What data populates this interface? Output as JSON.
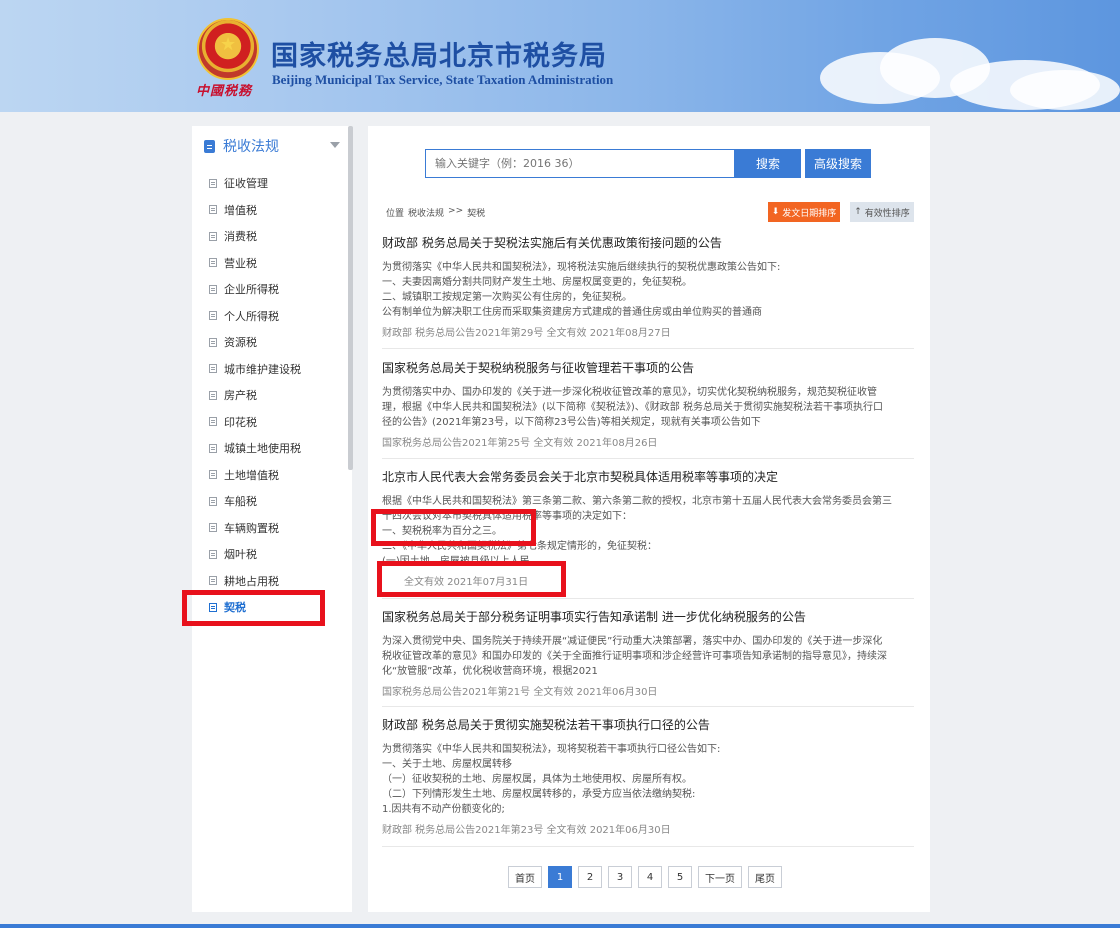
{
  "header": {
    "title_cn": "国家税务总局北京市税务局",
    "title_en": "Beijing Municipal Tax Service, State Taxation Administration",
    "emblem_text": "中國税務"
  },
  "sidebar": {
    "heading": "税收法规",
    "items": [
      {
        "label": "征收管理"
      },
      {
        "label": "增值税"
      },
      {
        "label": "消费税"
      },
      {
        "label": "营业税"
      },
      {
        "label": "企业所得税"
      },
      {
        "label": "个人所得税"
      },
      {
        "label": "资源税"
      },
      {
        "label": "城市维护建设税"
      },
      {
        "label": "房产税"
      },
      {
        "label": "印花税"
      },
      {
        "label": "城镇土地使用税"
      },
      {
        "label": "土地增值税"
      },
      {
        "label": "车船税"
      },
      {
        "label": "车辆购置税"
      },
      {
        "label": "烟叶税"
      },
      {
        "label": "耕地占用税"
      },
      {
        "label": "契税"
      }
    ]
  },
  "search": {
    "placeholder": "输入关键字（例：2016 36）",
    "search_label": "搜索",
    "advanced_label": "高级搜索"
  },
  "breadcrumb": {
    "prefix": "位置",
    "level1": "税收法规",
    "separator": ">>",
    "level2": "契税"
  },
  "sort": {
    "by_date": "发文日期排序",
    "by_validity": "有效性排序"
  },
  "articles": [
    {
      "title": "财政部 税务总局关于契税法实施后有关优惠政策衔接问题的公告",
      "lines": [
        "为贯彻落实《中华人民共和国契税法》，现将税法实施后继续执行的契税优惠政策公告如下:",
        "一、夫妻因离婚分割共同财产发生土地、房屋权属变更的，免征契税。",
        "二、城镇职工按规定第一次购买公有住房的，免征契税。",
        "公有制单位为解决职工住房而采取集资建房方式建成的普通住房或由单位购买的普通商"
      ],
      "meta": "财政部 税务总局公告2021年第29号   全文有效   2021年08月27日"
    },
    {
      "title": "国家税务总局关于契税纳税服务与征收管理若干事项的公告",
      "lines": [
        "为贯彻落实中办、国办印发的《关于进一步深化税收征管改革的意见》，切实优化契税纳税服务，规范契税征收管",
        "理，根据《中华人民共和国契税法》(以下简称《契税法》)、《财政部 税务总局关于贯彻实施契税法若干事项执行口",
        "径的公告》(2021年第23号，以下简称23号公告)等相关规定，现就有关事项公告如下"
      ],
      "meta": "国家税务总局公告2021年第25号   全文有效   2021年08月26日"
    },
    {
      "title": "北京市人民代表大会常务委员会关于北京市契税具体适用税率等事项的决定",
      "lines": [
        "根据《中华人民共和国契税法》第三条第二款、第六条第二款的授权，北京市第十五届人民代表大会常务委员会第三",
        "十四次会议对本市契税具体适用税率等事项的决定如下：",
        "一、契税税率为百分之三。",
        "二、《中华人民共和国契税法》第七条规定情形的，免征契税：",
        "(一)因土地、房屋被县级以上人民"
      ],
      "meta": "全文有效   2021年07月31日"
    },
    {
      "title": "国家税务总局关于部分税务证明事项实行告知承诺制 进一步优化纳税服务的公告",
      "lines": [
        "为深入贯彻党中央、国务院关于持续开展“减证便民”行动重大决策部署，落实中办、国办印发的《关于进一步深化",
        "税收征管改革的意见》和国办印发的《关于全面推行证明事项和涉企经营许可事项告知承诺制的指导意见》，持续深",
        "化“放管服”改革，优化税收营商环境，根据2021"
      ],
      "meta": "国家税务总局公告2021年第21号   全文有效   2021年06月30日"
    },
    {
      "title": "财政部 税务总局关于贯彻实施契税法若干事项执行口径的公告",
      "lines": [
        "为贯彻落实《中华人民共和国契税法》，现将契税若干事项执行口径公告如下:",
        "一、关于土地、房屋权属转移",
        "（一）征收契税的土地、房屋权属，具体为土地使用权、房屋所有权。",
        "（二）下列情形发生土地、房屋权属转移的，承受方应当依法缴纳契税:",
        "1.因共有不动产份额变化的;"
      ],
      "meta": "财政部 税务总局公告2021年第23号   全文有效   2021年06月30日"
    }
  ],
  "pagination": {
    "first": "首页",
    "pages": [
      "1",
      "2",
      "3",
      "4",
      "5"
    ],
    "current": "1",
    "next": "下一页",
    "last": "尾页"
  },
  "colors": {
    "accent": "#3a7bd5",
    "highlight": "#e8111c",
    "sort_active": "#f26522"
  }
}
